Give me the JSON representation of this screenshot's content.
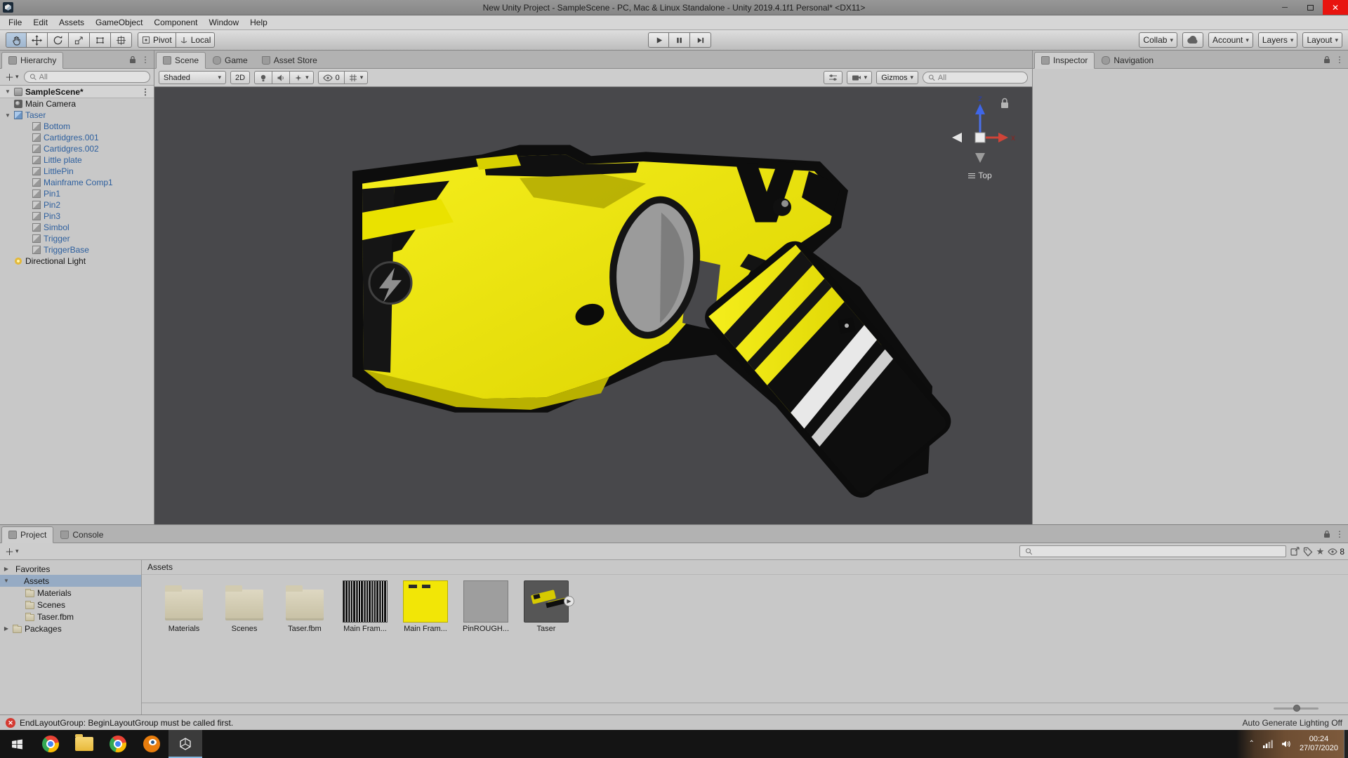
{
  "colors": {
    "taser_yellow": "#ece400",
    "scene_background": "#48484b",
    "error_red": "#d43a31",
    "prefab_blue": "#2d5f9e",
    "selection_gray_blue": "#96abc4"
  },
  "title_bar": {
    "title": "New Unity Project - SampleScene - PC, Mac & Linux Standalone - Unity 2019.4.1f1 Personal* <DX11>"
  },
  "menu_bar": {
    "items": [
      "File",
      "Edit",
      "Assets",
      "GameObject",
      "Component",
      "Window",
      "Help"
    ]
  },
  "toolbar": {
    "pivot": "Pivot",
    "local": "Local",
    "collab": "Collab",
    "account": "Account",
    "layers": "Layers",
    "layout": "Layout"
  },
  "hierarchy_panel": {
    "tab": "Hierarchy",
    "search_placeholder": "All",
    "scene_name": "SampleScene*",
    "items": [
      {
        "label": "Main Camera",
        "icon": "camera",
        "style": "normal",
        "level": 1,
        "arrow": ""
      },
      {
        "label": "Taser",
        "icon": "prefab",
        "style": "prefab",
        "level": 1,
        "arrow": "▼"
      },
      {
        "label": "Bottom",
        "icon": "cube",
        "style": "prefab",
        "level": 2,
        "arrow": ""
      },
      {
        "label": "Cartidgres.001",
        "icon": "cube",
        "style": "prefab",
        "level": 2,
        "arrow": ""
      },
      {
        "label": "Cartidgres.002",
        "icon": "cube",
        "style": "prefab",
        "level": 2,
        "arrow": ""
      },
      {
        "label": "Little plate",
        "icon": "cube",
        "style": "prefab",
        "level": 2,
        "arrow": ""
      },
      {
        "label": "LittlePin",
        "icon": "cube",
        "style": "prefab",
        "level": 2,
        "arrow": ""
      },
      {
        "label": "Mainframe Comp1",
        "icon": "cube",
        "style": "prefab",
        "level": 2,
        "arrow": ""
      },
      {
        "label": "Pin1",
        "icon": "cube",
        "style": "prefab",
        "level": 2,
        "arrow": ""
      },
      {
        "label": "Pin2",
        "icon": "cube",
        "style": "prefab",
        "level": 2,
        "arrow": ""
      },
      {
        "label": "Pin3",
        "icon": "cube",
        "style": "prefab",
        "level": 2,
        "arrow": ""
      },
      {
        "label": "Simbol",
        "icon": "cube",
        "style": "prefab",
        "level": 2,
        "arrow": ""
      },
      {
        "label": "Trigger",
        "icon": "cube",
        "style": "prefab",
        "level": 2,
        "arrow": ""
      },
      {
        "label": "TriggerBase",
        "icon": "cube",
        "style": "prefab",
        "level": 2,
        "arrow": ""
      },
      {
        "label": "Directional Light",
        "icon": "light",
        "style": "normal",
        "level": 1,
        "arrow": ""
      }
    ]
  },
  "scene_panel": {
    "tabs": [
      "Scene",
      "Game",
      "Asset Store"
    ],
    "shading": "Shaded",
    "toggle_2d": "2D",
    "hidden_count": "0",
    "gizmos": "Gizmos",
    "search_placeholder": "All",
    "gizmo": {
      "axis_up": "z",
      "axis_right": "x",
      "view": "Top"
    }
  },
  "inspector_panel": {
    "tabs": [
      "Inspector",
      "Navigation"
    ]
  },
  "project_panel": {
    "tabs": [
      "Project",
      "Console"
    ],
    "hidden_count": "8",
    "location": "Assets",
    "tree": [
      {
        "label": "Favorites",
        "icon": "star",
        "level": 0,
        "arrow": "▶",
        "selected": false
      },
      {
        "label": "Assets",
        "icon": "none",
        "level": 0,
        "arrow": "▼",
        "selected": true
      },
      {
        "label": "Materials",
        "icon": "folder",
        "level": 1,
        "arrow": "",
        "selected": false
      },
      {
        "label": "Scenes",
        "icon": "folder",
        "level": 1,
        "arrow": "",
        "selected": false
      },
      {
        "label": "Taser.fbm",
        "icon": "folder",
        "level": 1,
        "arrow": "",
        "selected": false
      },
      {
        "label": "Packages",
        "icon": "folder",
        "level": 0,
        "arrow": "▶",
        "selected": false
      }
    ],
    "items": [
      {
        "label": "Materials",
        "thumb": "folder"
      },
      {
        "label": "Scenes",
        "thumb": "folder"
      },
      {
        "label": "Taser.fbm",
        "thumb": "folder"
      },
      {
        "label": "Main Fram...",
        "thumb": "noise"
      },
      {
        "label": "Main Fram...",
        "thumb": "yellow"
      },
      {
        "label": "PinROUGH...",
        "thumb": "gray"
      },
      {
        "label": "Taser",
        "thumb": "model",
        "expand": true
      }
    ]
  },
  "status_bar": {
    "error": "EndLayoutGroup: BeginLayoutGroup must be called first.",
    "lighting": "Auto Generate Lighting Off"
  },
  "taskbar": {
    "time": "00:24",
    "date": "27/07/2020"
  }
}
